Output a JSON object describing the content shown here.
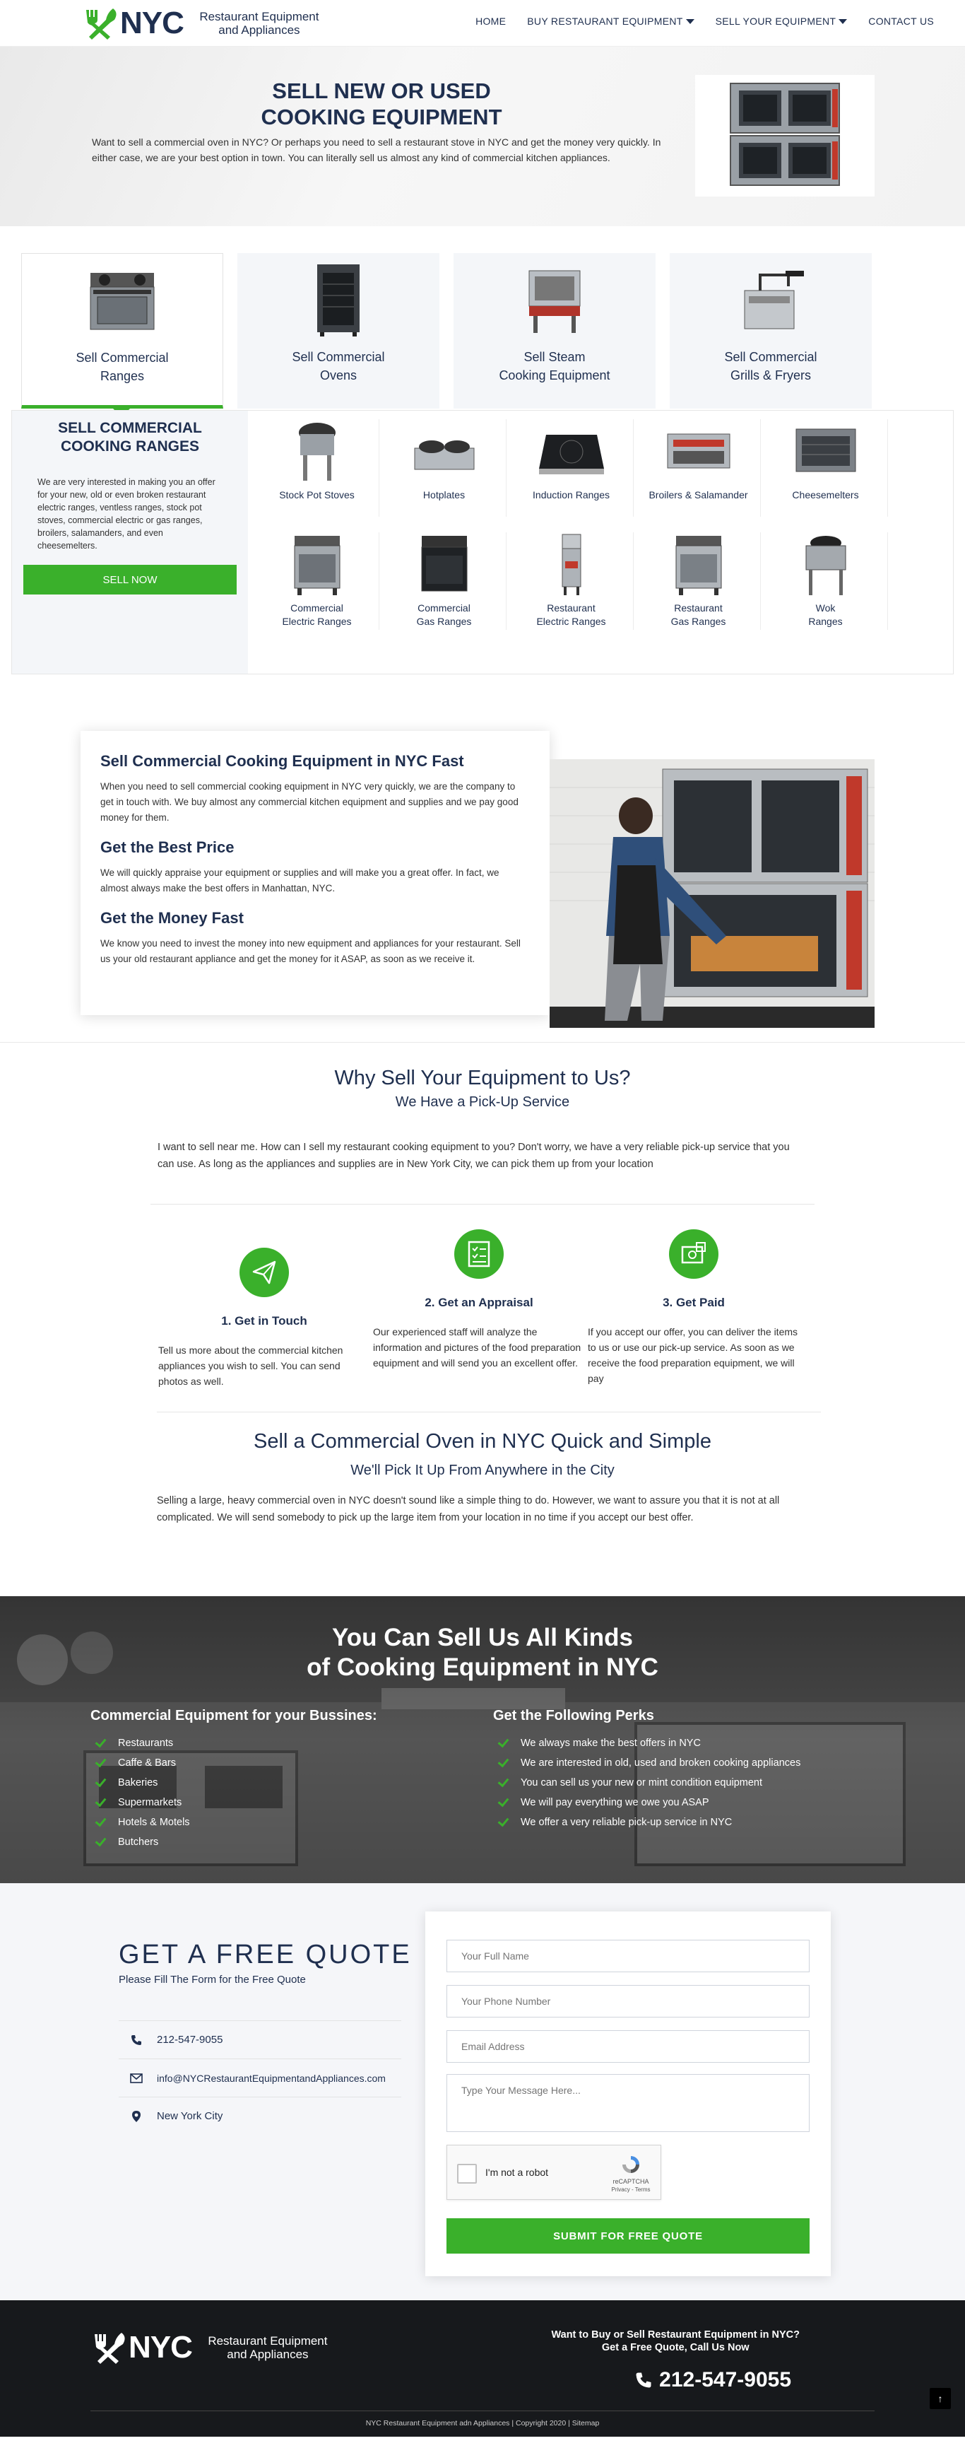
{
  "header": {
    "logo_text": "NYC",
    "logo_sub": "Restaurant Equipment and Appliances",
    "nav": [
      {
        "label": "HOME"
      },
      {
        "label": "BUY RESTAURANT EQUIPMENT"
      },
      {
        "label": "SELL YOUR EQUIPMENT"
      },
      {
        "label": "CONTACT US"
      }
    ]
  },
  "hero": {
    "title_line1": "SELL NEW OR USED",
    "title_line2": "COOKING EQUIPMENT",
    "text": "Want to sell a commercial oven in NYC? Or perhaps you need to sell a restaurant stove in NYC and get the money very quickly. In either case, we are your best option in town. You can literally sell us almost any kind of commercial kitchen appliances."
  },
  "categories": [
    {
      "line1": "Sell Commercial",
      "line2": "Ranges"
    },
    {
      "line1": "Sell Commercial",
      "line2": "Ovens"
    },
    {
      "line1": "Sell Steam",
      "line2": "Cooking Equipment"
    },
    {
      "line1": "Sell Commercial",
      "line2": "Grills & Fryers"
    }
  ],
  "ranges_panel": {
    "title": "SELL COMMERCIAL COOKING RANGES",
    "text": "We are very interested in making you an offer for your new, old or even broken restaurant electric ranges, ventless ranges, stock pot stoves, commercial electric or gas ranges, broilers, salamanders, and even cheesemelters.",
    "button": "SELL NOW",
    "items": [
      {
        "line1": "Stock Pot Stoves",
        "line2": ""
      },
      {
        "line1": "Hotplates",
        "line2": ""
      },
      {
        "line1": "Induction Ranges",
        "line2": ""
      },
      {
        "line1": "Broilers & Salamander",
        "line2": ""
      },
      {
        "line1": "Cheesemelters",
        "line2": ""
      },
      {
        "line1": "Commercial",
        "line2": "Electric Ranges"
      },
      {
        "line1": "Commercial",
        "line2": "Gas Ranges"
      },
      {
        "line1": "Restaurant",
        "line2": "Electric Ranges"
      },
      {
        "line1": "Restaurant",
        "line2": "Gas Ranges"
      },
      {
        "line1": "Wok",
        "line2": "Ranges"
      }
    ]
  },
  "info": {
    "h1": "Sell Commercial Cooking Equipment in NYC Fast",
    "p1": "When you need to sell commercial cooking equipment in NYC very quickly, we are the company to get in touch with. We buy almost any commercial kitchen equipment and supplies and we pay good money for them.",
    "h2": "Get the Best Price",
    "p2": "We will quickly appraise your equipment or supplies and will make you a great offer. In fact, we almost always make the best offers in Manhattan, NYC.",
    "h3": "Get the Money Fast",
    "p3": "We know you need to invest the money into new equipment and appliances for your restaurant. Sell us your old restaurant appliance and get the money for it ASAP, as soon as we receive it."
  },
  "why": {
    "title": "Why Sell Your Equipment to Us?",
    "subtitle": "We Have a Pick-Up Service",
    "text": "I want to sell near me. How can I sell my restaurant cooking equipment to you? Don't worry, we have a very reliable pick-up service that you can use. As long as the appliances and supplies are in New York City, we can pick them up from your location",
    "steps": [
      {
        "title": "1. Get in Touch",
        "text": "Tell us more about the commercial kitchen appliances you wish to sell. You can send photos as well."
      },
      {
        "title": "2. Get an Appraisal",
        "text": "Our experienced staff will analyze the information and pictures of the food preparation equipment and will send you an excellent offer."
      },
      {
        "title": "3. Get Paid",
        "text": "If you accept our offer, you can deliver the items to us or use our pick-up service. As soon as we receive the food preparation equipment, we will pay"
      }
    ],
    "oven_title": "Sell a Commercial Oven in NYC Quick and Simple",
    "oven_sub": "We'll Pick It Up From Anywhere in the City",
    "oven_text": "Selling a large, heavy commercial oven in NYC doesn't sound like a simple thing to do. However, we want to assure you that it is not at all complicated. We will send somebody to pick up the large item from your location in no time if you accept our best offer."
  },
  "banner": {
    "title_line1": "You Can Sell Us All Kinds",
    "title_line2": "of Cooking Equipment in NYC",
    "left_title": "Commercial Equipment for your Bussines:",
    "left_items": [
      "Restaurants",
      "Caffe & Bars",
      "Bakeries",
      "Supermarkets",
      "Hotels & Motels",
      "Butchers"
    ],
    "right_title": "Get the Following Perks",
    "right_items": [
      "We always make the best offers in NYC",
      "We are interested in old, used and broken cooking appliances",
      "You can sell us your new or mint condition equipment",
      "We will pay everything we owe you ASAP",
      "We offer a very reliable pick-up service in NYC"
    ]
  },
  "quote": {
    "title": "GET A FREE QUOTE",
    "subtitle": "Please Fill The Form for the Free Quote",
    "phone": "212-547-9055",
    "email": "info@NYCRestaurantEquipmentandAppliances.com",
    "location": "New York City",
    "form": {
      "name_placeholder": "Your Full Name",
      "phone_placeholder": "Your Phone Number",
      "email_placeholder": "Email Address",
      "message_placeholder": "Type Your Message Here...",
      "captcha_label": "I'm not a robot",
      "captcha_brand": "reCAPTCHA",
      "captcha_links": "Privacy - Terms",
      "submit": "SUBMIT FOR FREE QUOTE"
    }
  },
  "footer": {
    "logo_text": "NYC",
    "logo_sub": "Restaurant Equipment and Appliances",
    "cta_line1": "Want to Buy or Sell Restaurant Equipment in NYC?",
    "cta_line2": "Get a Free Quote, Call Us Now",
    "phone": "212-547-9055",
    "copyright": "NYC Restaurant Equipment adn Appliances | Copyright 2020 | Sitemap",
    "to_top": "↑"
  },
  "colors": {
    "accent": "#3ab02b",
    "navy": "#1f2f4f",
    "footer": "#17191c"
  }
}
